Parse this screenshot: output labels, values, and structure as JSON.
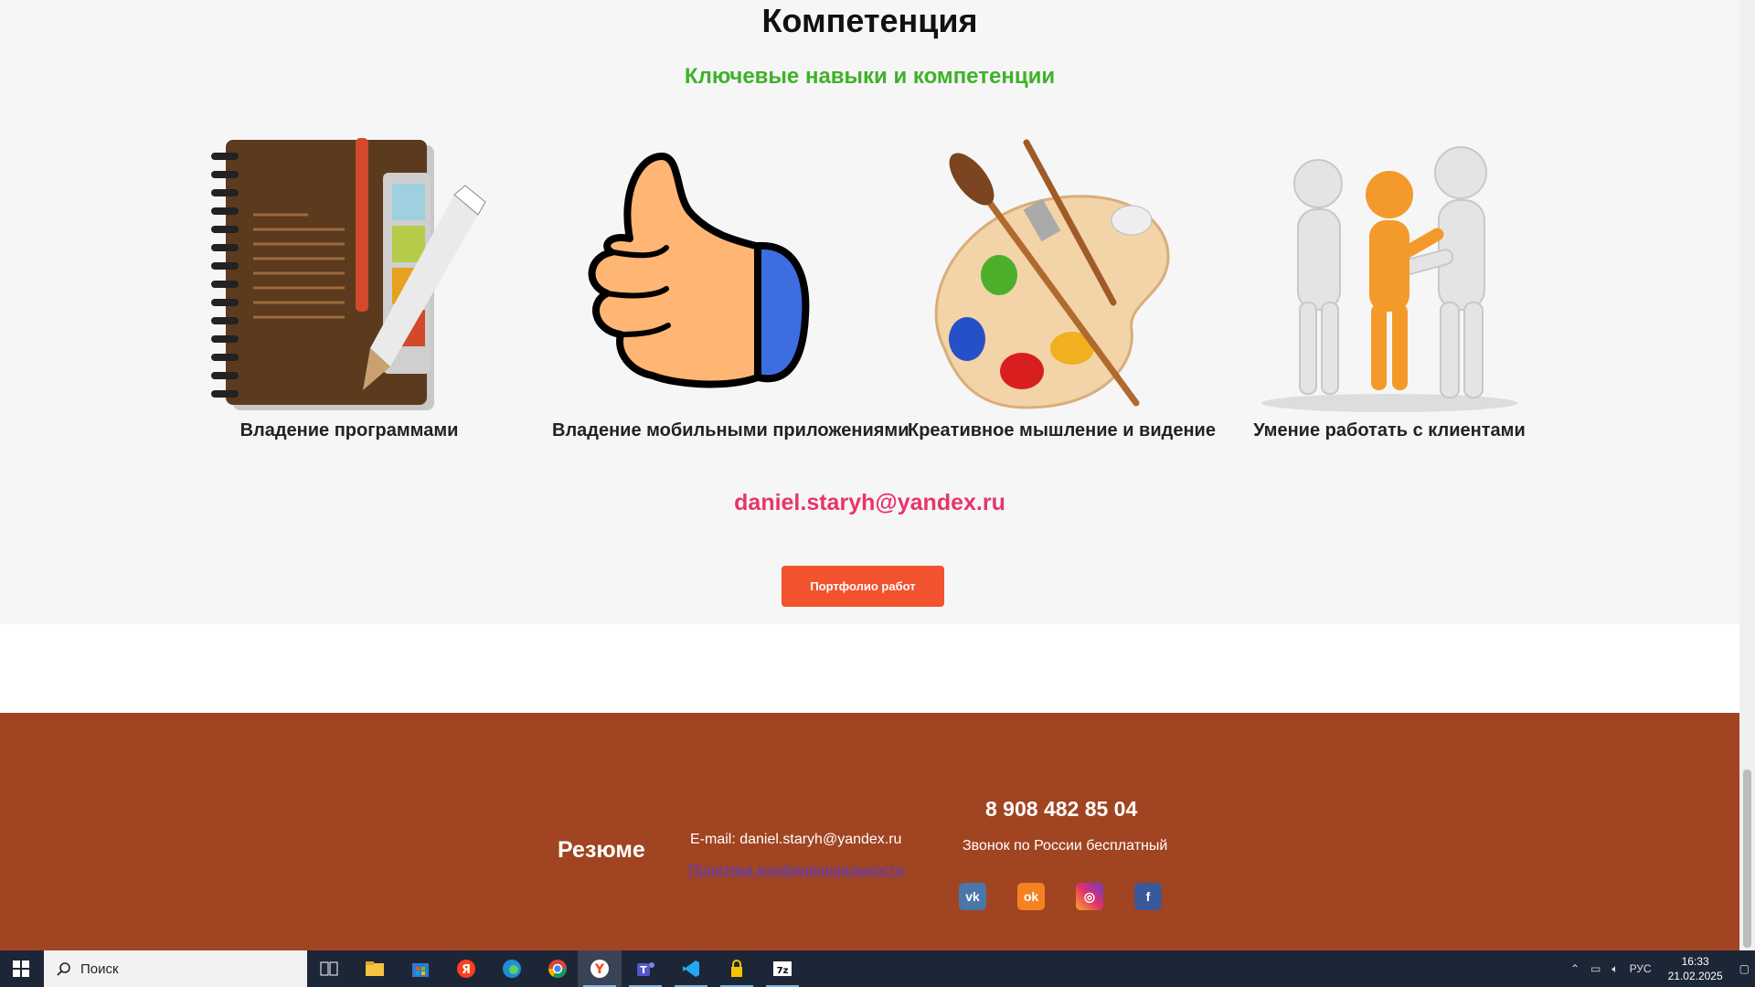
{
  "competence": {
    "title": "Компетенция",
    "subtitle": "Ключевые навыки и компетенции",
    "skills": [
      {
        "label": "Владение программами",
        "icon": "notebook-pencil-icon"
      },
      {
        "label": "Владение мобильными приложениями",
        "icon": "thumbs-up-icon"
      },
      {
        "label": "Креативное мышление и видение",
        "icon": "paint-palette-icon"
      },
      {
        "label": "Умение работать с клиентами",
        "icon": "people-handshake-icon"
      }
    ],
    "email": "daniel.staryh@yandex.ru",
    "portfolio_button": "Портфолио работ"
  },
  "footer": {
    "brand": "Резюме",
    "email": "E-mail: daniel.staryh@yandex.ru",
    "policy_link": "Политика конфиденциальности",
    "phone": "8 908 482 85 04",
    "phone_note": "Звонок по России бесплатный",
    "socials": [
      {
        "name": "vk",
        "glyph": "vk",
        "color": "#4a76a8"
      },
      {
        "name": "odnoklassniki",
        "glyph": "ok",
        "color": "#f58220"
      },
      {
        "name": "instagram",
        "glyph": "◎",
        "color": "#c13584"
      },
      {
        "name": "facebook",
        "glyph": "f",
        "color": "#3b5998"
      }
    ]
  },
  "taskbar": {
    "search_placeholder": "Поиск",
    "language": "РУС",
    "time": "16:33",
    "date": "21.02.2025"
  },
  "colors": {
    "accent_green": "#3fb12a",
    "accent_pink": "#e8346b",
    "button_orange": "#f2522e",
    "footer_brown": "#a14421"
  }
}
